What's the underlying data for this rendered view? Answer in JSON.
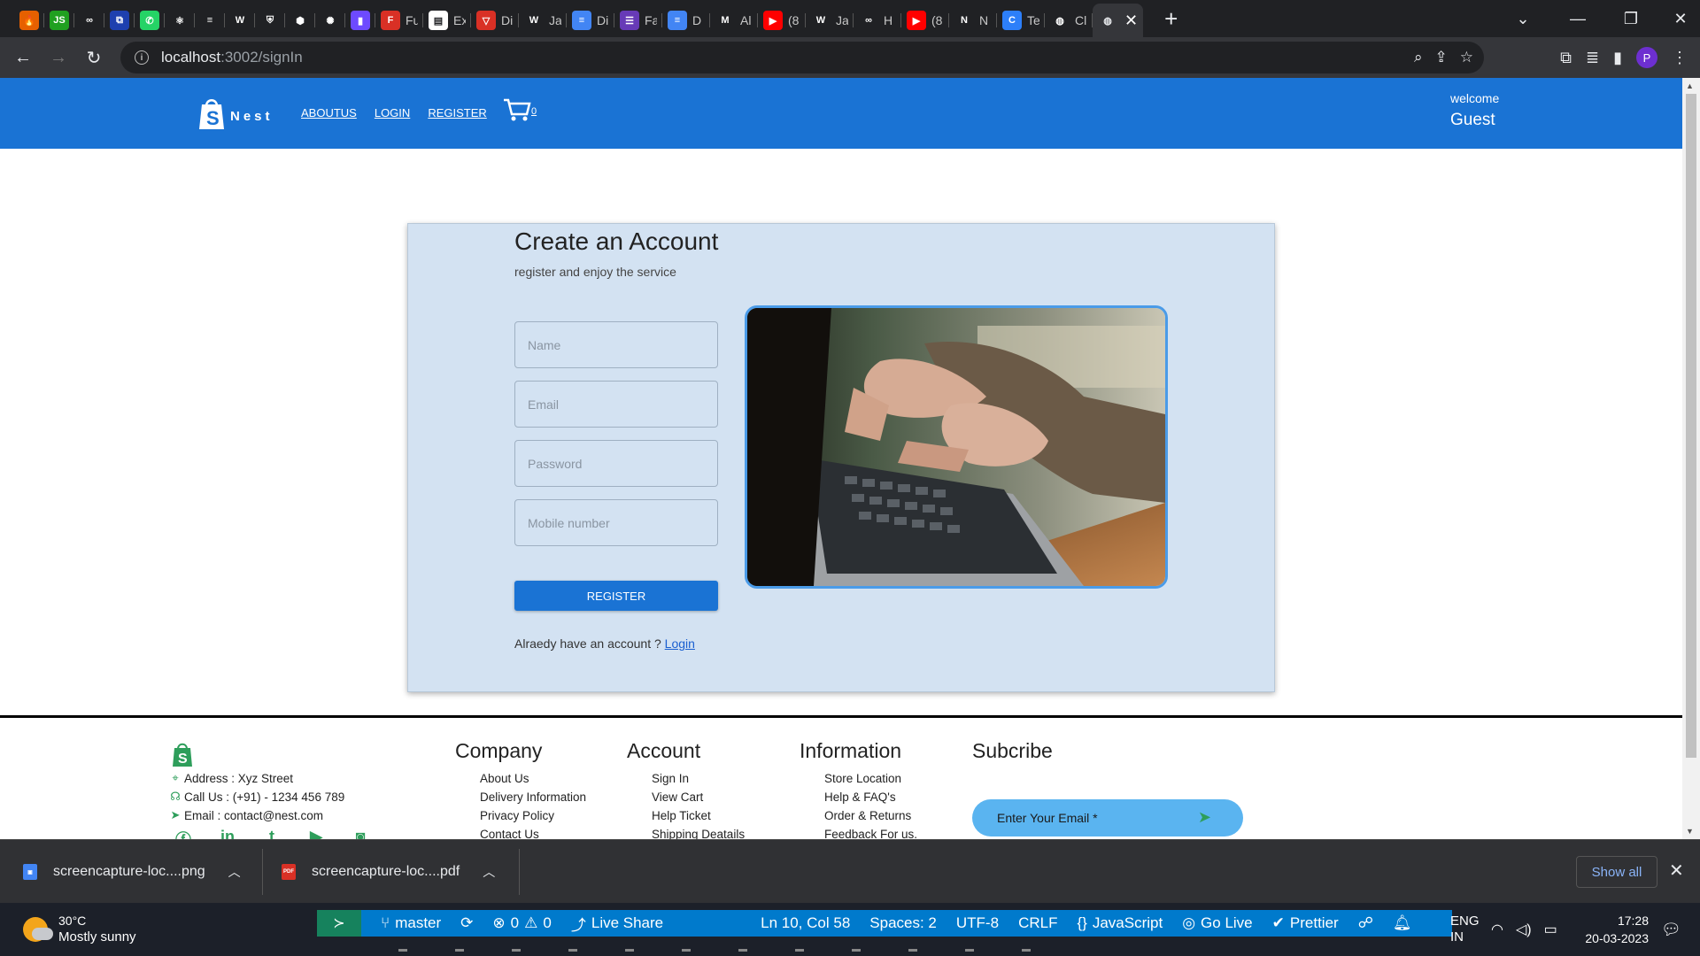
{
  "browser": {
    "tabs": [
      {
        "icon": "firefox-icon",
        "title": "",
        "color": "#e66000",
        "glyph": "🔥"
      },
      {
        "icon": "js-icon",
        "title": "",
        "color": "#20a020",
        "glyph": "JS"
      },
      {
        "icon": "infinity-icon",
        "title": "",
        "color": "#202124",
        "glyph": "∞"
      },
      {
        "icon": "code-icon",
        "title": "",
        "color": "#1e40af",
        "glyph": "⧉"
      },
      {
        "icon": "whatsapp-icon",
        "title": "",
        "color": "#25d366",
        "glyph": "✆"
      },
      {
        "icon": "react-icon",
        "title": "",
        "color": "#202124",
        "glyph": "⚛"
      },
      {
        "icon": "stack-icon",
        "title": "",
        "color": "#202124",
        "glyph": "≡"
      },
      {
        "icon": "w-icon",
        "title": "",
        "color": "#202124",
        "glyph": "W"
      },
      {
        "icon": "shield-icon",
        "title": "",
        "color": "#202124",
        "glyph": "⛨"
      },
      {
        "icon": "pin-icon",
        "title": "",
        "color": "#202124",
        "glyph": "⬢"
      },
      {
        "icon": "chatgpt-icon",
        "title": "",
        "color": "#202124",
        "glyph": "✺"
      },
      {
        "icon": "purple-icon",
        "title": "",
        "color": "#6d4aff",
        "glyph": "▮"
      },
      {
        "icon": "f-icon",
        "title": "Fu",
        "color": "#d93025",
        "glyph": "F"
      },
      {
        "icon": "doc-icon",
        "title": "Ex",
        "color": "#ffffff",
        "glyph": "▤"
      },
      {
        "icon": "vercel-icon",
        "title": "Di",
        "color": "#d93025",
        "glyph": "▽"
      },
      {
        "icon": "w-icon",
        "title": "Ja",
        "color": "#202124",
        "glyph": "W"
      },
      {
        "icon": "gdoc-icon",
        "title": "Di",
        "color": "#4285f4",
        "glyph": "≡"
      },
      {
        "icon": "form-icon",
        "title": "Fa",
        "color": "#673ab7",
        "glyph": "☰"
      },
      {
        "icon": "gdoc-icon",
        "title": "D",
        "color": "#4285f4",
        "glyph": "≡"
      },
      {
        "icon": "m-icon",
        "title": "Al",
        "color": "#202124",
        "glyph": "M"
      },
      {
        "icon": "youtube-icon",
        "title": "(8",
        "color": "#ff0000",
        "glyph": "▶"
      },
      {
        "icon": "w-icon",
        "title": "Ja",
        "color": "#202124",
        "glyph": "W"
      },
      {
        "icon": "infinity-icon",
        "title": "H",
        "color": "#202124",
        "glyph": "∞"
      },
      {
        "icon": "youtube-icon",
        "title": "(8",
        "color": "#ff0000",
        "glyph": "▶"
      },
      {
        "icon": "n-icon",
        "title": "N",
        "color": "#202124",
        "glyph": "N"
      },
      {
        "icon": "c-icon",
        "title": "Te",
        "color": "#2d7ff9",
        "glyph": "C"
      },
      {
        "icon": "globe-icon",
        "title": "Cl",
        "color": "#202124",
        "glyph": "◍"
      }
    ],
    "active_tab_icon": "globe-icon",
    "url_host": "localhost",
    "url_path": ":3002/signIn",
    "profile_initial": "P"
  },
  "site": {
    "logo_text": "Nest",
    "nav": [
      "ABOUTUS",
      "LOGIN",
      "REGISTER"
    ],
    "cart_count": "0",
    "welcome_label": "welcome",
    "welcome_user": "Guest",
    "brand_color": "#1a73d4"
  },
  "form": {
    "title": "Create an Account",
    "subtitle": "register and enjoy the service",
    "placeholders": {
      "name": "Name",
      "email": "Email",
      "password": "Password",
      "mobile": "Mobile number"
    },
    "register_label": "REGISTER",
    "already_text": "Alraedy have an account ?",
    "login_link": "Login"
  },
  "footer": {
    "address": "Address : Xyz Street",
    "phone": "Call Us : (+91) - 1234 456 789",
    "email": "Email : contact@nest.com",
    "columns": [
      {
        "title": "Company",
        "items": [
          "About Us",
          "Delivery Information",
          "Privacy Policy",
          "Contact Us"
        ]
      },
      {
        "title": "Account",
        "items": [
          "Sign In",
          "View Cart",
          "Help Ticket",
          "Shipping Deatails"
        ]
      },
      {
        "title": "Information",
        "items": [
          "Store Location",
          "Help & FAQ's",
          "Order & Returns",
          "Feedback For us."
        ]
      }
    ],
    "subscribe_title": "Subcribe",
    "subscribe_placeholder": "Enter Your Email *",
    "socials": [
      "facebook-icon",
      "linkedin-icon",
      "tumblr-icon",
      "youtube-icon",
      "instagram-icon"
    ]
  },
  "downloads": {
    "items": [
      "screencapture-loc....png",
      "screencapture-loc....pdf"
    ],
    "show_all": "Show all"
  },
  "taskbar": {
    "temp": "30°C",
    "weather": "Mostly sunny",
    "branch": "master",
    "problems_errors": "0",
    "problems_warnings": "0",
    "live_share": "Live Share",
    "cursor": "Ln 10, Col 58",
    "spaces": "Spaces: 2",
    "encoding": "UTF-8",
    "eol": "CRLF",
    "language": "JavaScript",
    "go_live": "Go Live",
    "prettier": "Prettier",
    "lang_line1": "ENG",
    "lang_line2": "IN",
    "time": "17:28",
    "date": "20-03-2023"
  }
}
